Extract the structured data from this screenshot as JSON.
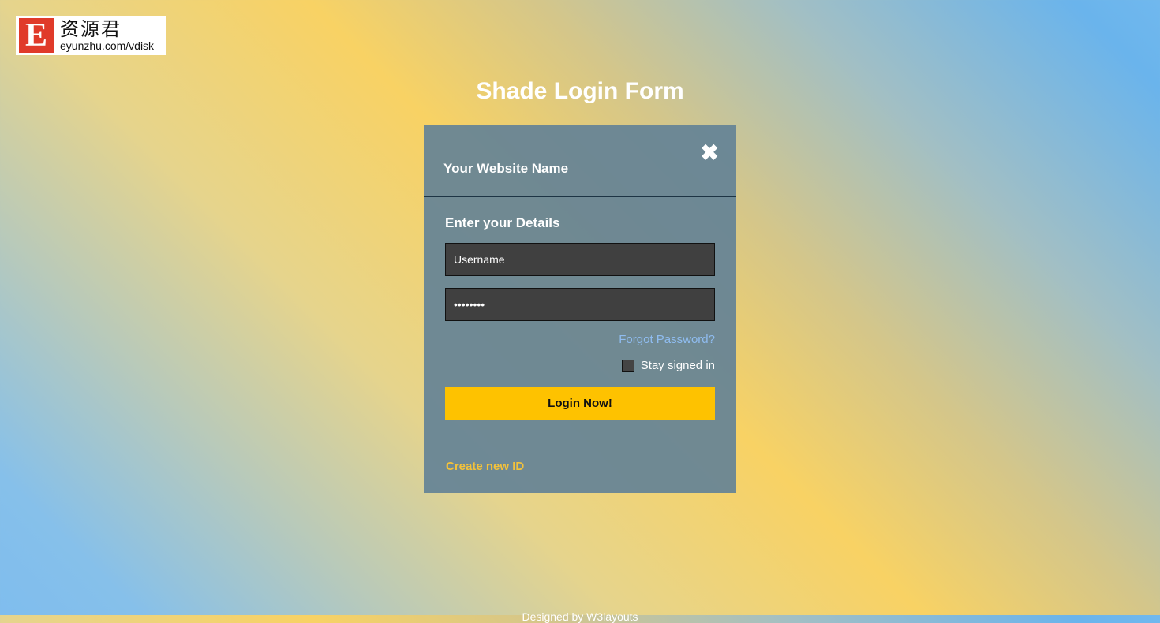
{
  "logo": {
    "letter": "E",
    "chinese": "资源君",
    "url": "eyunzhu.com/vdisk"
  },
  "title": "Shade Login Form",
  "card": {
    "site_name": "Your Website Name",
    "close_icon": "close-icon",
    "details_heading": "Enter your Details",
    "username": {
      "value": "Username"
    },
    "password": {
      "value": "••••••••"
    },
    "forgot_label": "Forgot Password?",
    "stay_signed_in": {
      "label": "Stay signed in",
      "checked": false
    },
    "login_label": "Login Now!",
    "create_label": "Create new ID"
  },
  "footer": "Designed by W3layouts",
  "colors": {
    "accent": "#fec200",
    "link": "#8fbcf0",
    "create": "#f4c23a",
    "card": "#64829a"
  }
}
